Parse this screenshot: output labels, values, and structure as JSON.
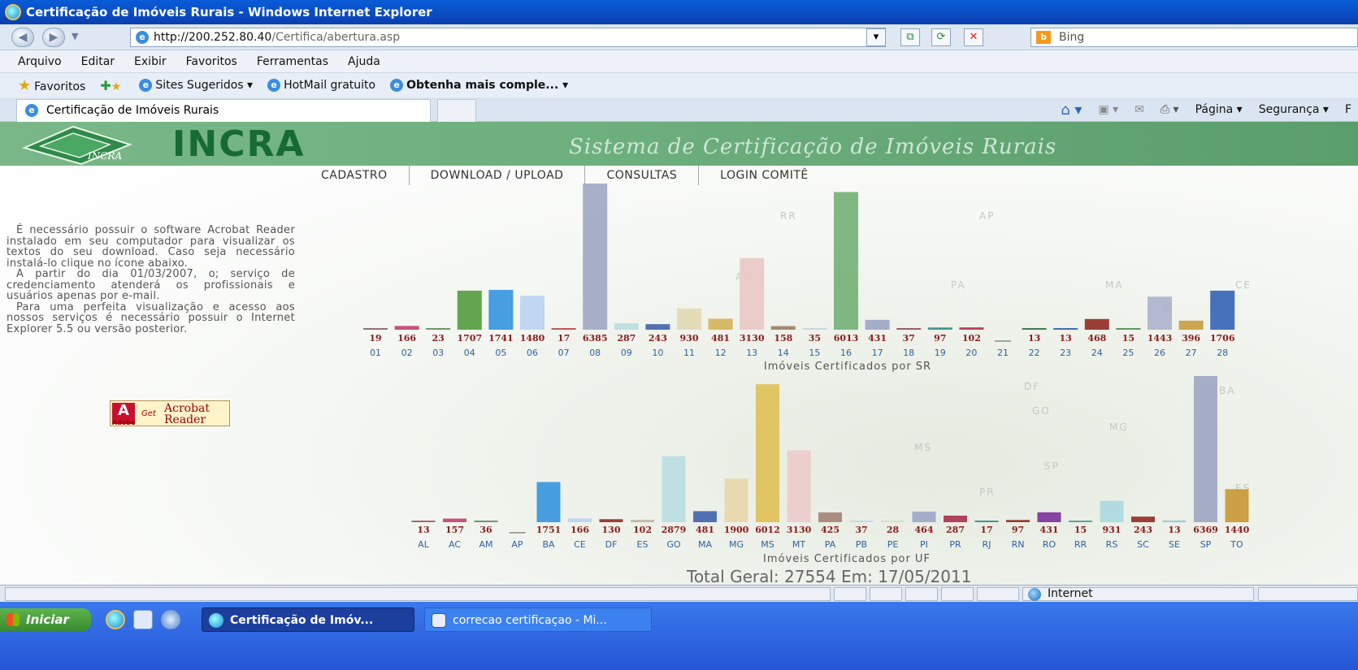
{
  "window": {
    "title": "Certificação de Imóveis Rurais - Windows Internet Explorer"
  },
  "addressbar": {
    "url_host": "http://200.252.80.40",
    "url_path": "/Certifica/abertura.asp",
    "search_placeholder": "Bing"
  },
  "menu": [
    "Arquivo",
    "Editar",
    "Exibir",
    "Favoritos",
    "Ferramentas",
    "Ajuda"
  ],
  "favorites": {
    "favoritos": "Favoritos",
    "sites": "Sites Sugeridos ▾",
    "hotmail": "HotMail gratuito",
    "obtenha": "Obtenha mais comple... ▾"
  },
  "tabs": {
    "active": "Certificação de Imóveis Rurais"
  },
  "commandbar": {
    "pagina": "Página ▾",
    "seguranca": "Segurança ▾",
    "f": "F"
  },
  "site": {
    "brand": "INCRA",
    "logo_text": "INCRA",
    "system_title": "Sistema de Certificação de Imóveis Rurais",
    "nav": [
      "CADASTRO",
      "DOWNLOAD / UPLOAD",
      "CONSULTAS",
      "LOGIN COMITÊ"
    ],
    "info_p1": "É necessário possuir o software Acrobat Reader instalado em seu computador para visualizar os textos do seu download. Caso seja necessário instalá-lo clique no ícone abaixo.",
    "info_p2": "A partir do dia 01/03/2007, o; serviço de credenciamento atenderá os profissionais e usuários apenas por e-mail.",
    "info_p3": "Para uma perfeita visualização e acesso aos nossos serviços é necessário possuir o Internet Explorer 5.5 ou versão posterior.",
    "acrobat": {
      "adobe": "Adobe",
      "get": "Get",
      "line1": "Acrobat",
      "line2": "Reader"
    },
    "total": "Total Geral: 27554 Em: 17/05/2011",
    "map_labels": [
      "RR",
      "AP",
      "AM",
      "PA",
      "MA",
      "CE",
      "PI",
      "BA",
      "DF",
      "GO",
      "MG",
      "MS",
      "SP",
      "PR",
      "ES"
    ]
  },
  "chart_data": [
    {
      "type": "bar",
      "xlabel": "Imóveis Certificados por SR",
      "categories": [
        "01",
        "02",
        "03",
        "04",
        "05",
        "06",
        "07",
        "08",
        "09",
        "10",
        "11",
        "12",
        "13",
        "14",
        "15",
        "16",
        "17",
        "18",
        "19",
        "20",
        "21",
        "22",
        "23",
        "24",
        "25",
        "26",
        "27",
        "28"
      ],
      "values": [
        19,
        166,
        23,
        1707,
        1741,
        1480,
        17,
        6385,
        287,
        243,
        930,
        481,
        3130,
        158,
        35,
        6013,
        431,
        37,
        97,
        102,
        null,
        13,
        13,
        468,
        15,
        1443,
        396,
        1706
      ],
      "colors": [
        "#8b5a6b",
        "#c43a6a",
        "#5a8a5a",
        "#4f9a38",
        "#2f92de",
        "#b8d2f2",
        "#b3443a",
        "#9ca4c2",
        "#b8dde0",
        "#3a5ea8",
        "#e0d8b2",
        "#d4b154",
        "#e8c6c4",
        "#9a7a5a",
        "#c4d4e4",
        "#6fae72",
        "#9aa4c6",
        "#8a4a5a",
        "#2a8a8a",
        "#b22a4a",
        "#cccccc",
        "#2a6a3a",
        "#2a5aa8",
        "#8e241c",
        "#4a8a4a",
        "#a8b0cc",
        "#c89a3a",
        "#2f5fb4"
      ],
      "ylim": [
        0,
        6385
      ]
    },
    {
      "type": "bar",
      "xlabel": "Imóveis Certificados por UF",
      "categories": [
        "AL",
        "AC",
        "AM",
        "AP",
        "BA",
        "CE",
        "DF",
        "ES",
        "GO",
        "MA",
        "MG",
        "MS",
        "MT",
        "PA",
        "PB",
        "PE",
        "PI",
        "PR",
        "RJ",
        "RN",
        "RO",
        "RR",
        "RS",
        "SC",
        "SE",
        "SP",
        "TO"
      ],
      "values": [
        13,
        157,
        36,
        null,
        1751,
        166,
        130,
        102,
        2879,
        481,
        1900,
        6012,
        3130,
        425,
        37,
        28,
        464,
        287,
        17,
        97,
        431,
        15,
        931,
        243,
        13,
        6369,
        1440
      ],
      "colors": [
        "#8a5a6a",
        "#c43a6a",
        "#5a8a5a",
        "#c8c4a0",
        "#2f92de",
        "#b8d2f2",
        "#8e241c",
        "#c0b0a0",
        "#b8dde0",
        "#3a5ea8",
        "#e8d6a8",
        "#dfbe52",
        "#eccac8",
        "#a08070",
        "#c4d4e4",
        "#d0e0c0",
        "#9aa4c6",
        "#a82a4a",
        "#2a8a8a",
        "#8e241c",
        "#7a2a9a",
        "#4a9a8a",
        "#a8d8e0",
        "#8e241c",
        "#8ac4e0",
        "#9ca4c2",
        "#c8942e"
      ],
      "ylim": [
        0,
        6369
      ]
    }
  ],
  "statusbar": {
    "zone": "Internet"
  },
  "taskbar": {
    "start": "Iniciar",
    "task1": "Certificação de Imóv...",
    "task2": "correcao certificaçao - Mi..."
  }
}
